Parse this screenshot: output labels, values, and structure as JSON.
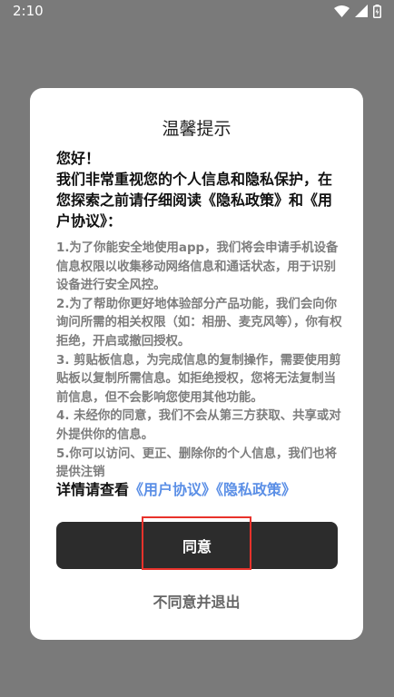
{
  "status_bar": {
    "time": "2:10",
    "icons": [
      "wifi-icon",
      "signal-icon",
      "battery-icon"
    ]
  },
  "dialog": {
    "title": "温馨提示",
    "greeting": "您好！",
    "intro": "我们非常重视您的个人信息和隐私保护，在您探索之前请仔细阅读《隐私政策》和《用户协议》：",
    "terms": [
      "1.为了你能安全地使用app，我们将会申请手机设备信息权限以收集移动网络信息和通话状态，用于识别设备进行安全风控。",
      "2.为了帮助你更好地体验部分产品功能，我们会向你询问所需的相关权限（如：相册、麦克风等），你有权拒绝，开启或撤回授权。",
      "3. 剪贴板信息，为完成信息的复制操作，需要使用剪贴板以复制所需信息。如拒绝授权，您将无法复制当前信息，但不会影响您使用其他功能。",
      "4. 未经你的同意，我们不会从第三方获取、共享或对外提供你的信息。",
      "5.你可以访问、更正、删除你的个人信息，我们也将提供注销"
    ],
    "details_prefix": "详情请查看",
    "user_agreement_link": "《用户协议》",
    "privacy_policy_link": "《隐私政策》",
    "agree_label": "同意",
    "disagree_label": "不同意并退出"
  },
  "colors": {
    "overlay": "#7a7a7a",
    "dialog_bg": "#ffffff",
    "button_dark": "#2c2c2c",
    "link": "#5b8fe6",
    "highlight": "#e8322b"
  }
}
